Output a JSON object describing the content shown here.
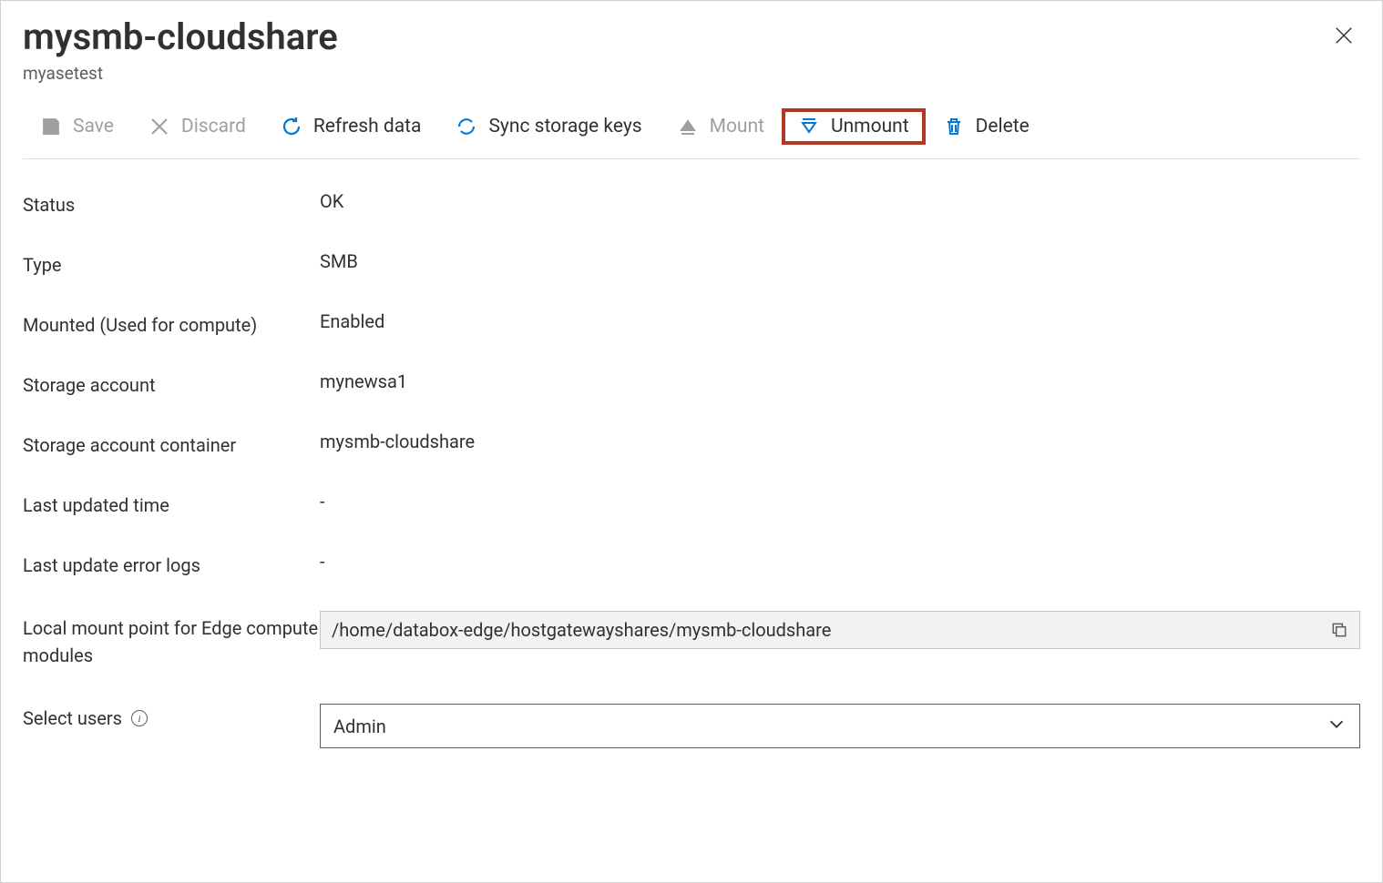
{
  "header": {
    "title": "mysmb-cloudshare",
    "subtitle": "myasetest"
  },
  "toolbar": {
    "save": "Save",
    "discard": "Discard",
    "refresh": "Refresh data",
    "sync": "Sync storage keys",
    "mount": "Mount",
    "unmount": "Unmount",
    "delete": "Delete"
  },
  "fields": {
    "status_label": "Status",
    "status_value": "OK",
    "type_label": "Type",
    "type_value": "SMB",
    "mounted_label": "Mounted (Used for compute)",
    "mounted_value": "Enabled",
    "storage_account_label": "Storage account",
    "storage_account_value": "mynewsa1",
    "container_label": "Storage account container",
    "container_value": "mysmb-cloudshare",
    "last_updated_label": "Last updated time",
    "last_updated_value": "-",
    "error_logs_label": "Last update error logs",
    "error_logs_value": "-",
    "mount_point_label": "Local mount point for Edge compute modules",
    "mount_point_value": "/home/databox-edge/hostgatewayshares/mysmb-cloudshare",
    "select_users_label": "Select users",
    "select_users_value": "Admin"
  }
}
